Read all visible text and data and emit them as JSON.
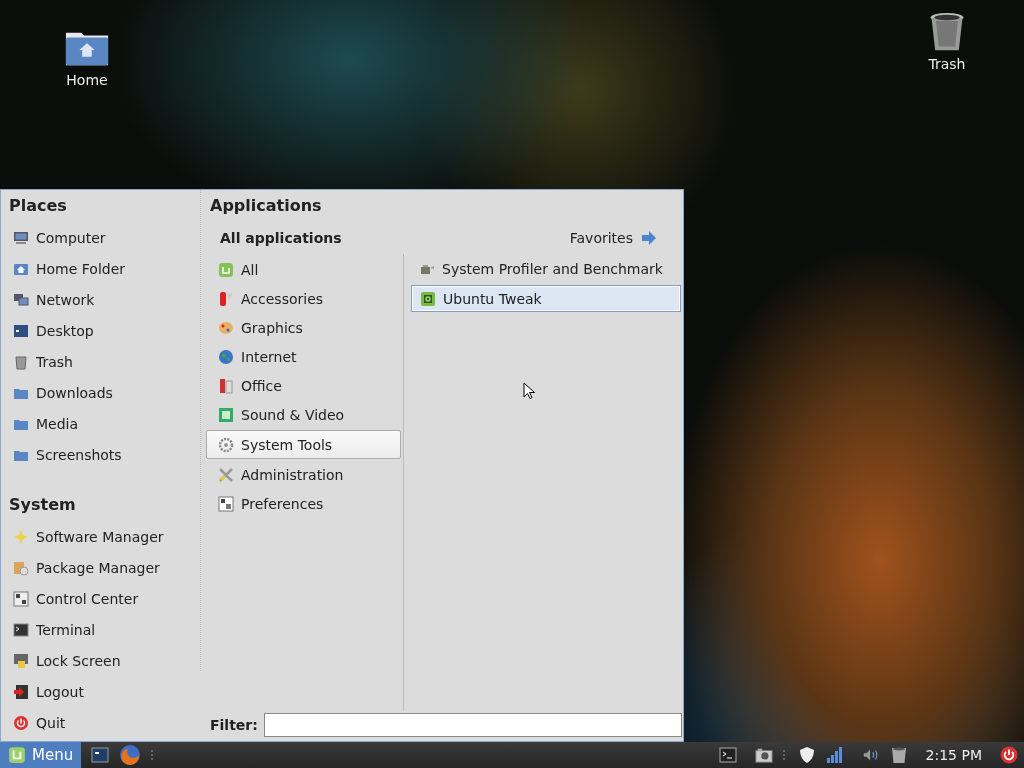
{
  "desktop_icons": [
    {
      "label": "Home"
    },
    {
      "label": "Trash"
    }
  ],
  "menu": {
    "places": {
      "title": "Places",
      "items": [
        {
          "label": "Computer"
        },
        {
          "label": "Home Folder"
        },
        {
          "label": "Network"
        },
        {
          "label": "Desktop"
        },
        {
          "label": "Trash"
        },
        {
          "label": "Downloads"
        },
        {
          "label": "Media"
        },
        {
          "label": "Screenshots"
        }
      ]
    },
    "system": {
      "title": "System",
      "items": [
        {
          "label": "Software Manager"
        },
        {
          "label": "Package Manager"
        },
        {
          "label": "Control Center"
        },
        {
          "label": "Terminal"
        },
        {
          "label": "Lock Screen"
        },
        {
          "label": "Logout"
        },
        {
          "label": "Quit"
        }
      ]
    },
    "applications": {
      "title": "Applications",
      "all_label": "All applications",
      "favorites_label": "Favorites",
      "categories": [
        {
          "label": "All",
          "selected": false
        },
        {
          "label": "Accessories",
          "selected": false
        },
        {
          "label": "Graphics",
          "selected": false
        },
        {
          "label": "Internet",
          "selected": false
        },
        {
          "label": "Office",
          "selected": false
        },
        {
          "label": "Sound & Video",
          "selected": false
        },
        {
          "label": "System Tools",
          "selected": true
        },
        {
          "label": "Administration",
          "selected": false
        },
        {
          "label": "Preferences",
          "selected": false
        }
      ],
      "apps": [
        {
          "label": "System Profiler and Benchmark",
          "selected": false
        },
        {
          "label": "Ubuntu Tweak",
          "selected": true
        }
      ]
    },
    "filter": {
      "label": "Filter:"
    }
  },
  "taskbar": {
    "menu_label": "Menu",
    "clock": "2:15 PM"
  }
}
